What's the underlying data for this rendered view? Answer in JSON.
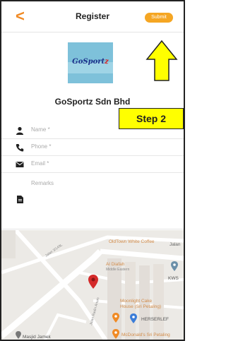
{
  "header": {
    "back_glyph": "<",
    "title": "Register",
    "submit_label": "Submit"
  },
  "company": {
    "logo_text_main": "GoSport",
    "logo_text_accent": "z",
    "name": "GoSportz Sdn Bhd"
  },
  "form": {
    "name_placeholder": "Name *",
    "phone_placeholder": "Phone *",
    "email_placeholder": "Email *",
    "remarks_placeholder": "Remarks"
  },
  "map": {
    "labels": {
      "oldtown": "OldTown White Coffee",
      "jalan": "Jalan",
      "aldiafah": "Al Diafah",
      "aldiafah_sub": "Middle Eastern",
      "kws": "KWS",
      "moonlight1": "Moonlight Cake",
      "moonlight2": "House (Sri Petaling)",
      "hersherlef": "HERSERLEF",
      "mcd": "McDonald's Sri Petaling",
      "masjid": "Masjid Jamek",
      "street1": "Jalan 3/149L",
      "street2": "Jalan Radin Anum"
    }
  },
  "annotation": {
    "step_label": "Step 2"
  },
  "colors": {
    "accent": "#f5a623",
    "back": "#f08a24",
    "pin": "#d42a2a",
    "step_bg": "#ffff00"
  }
}
